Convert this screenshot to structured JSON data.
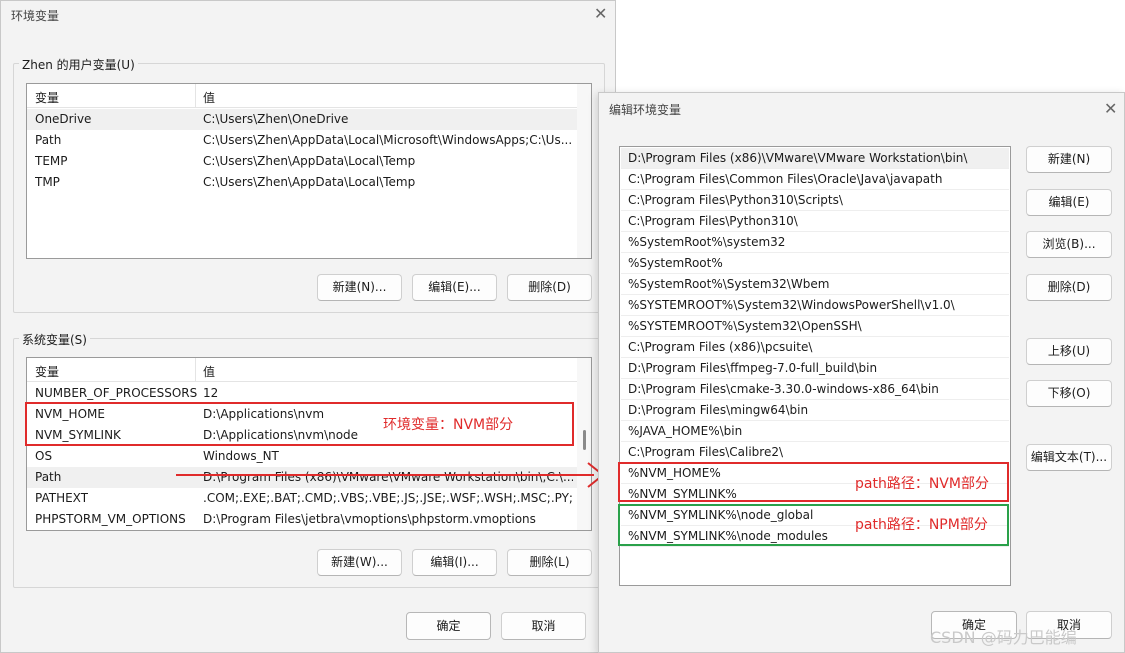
{
  "env_dialog": {
    "title": "环境变量",
    "user_group_label": "Zhen 的用户变量(U)",
    "col_var": "变量",
    "col_val": "值",
    "user_rows": [
      {
        "name": "OneDrive",
        "value": "C:\\Users\\Zhen\\OneDrive"
      },
      {
        "name": "Path",
        "value": "C:\\Users\\Zhen\\AppData\\Local\\Microsoft\\WindowsApps;C:\\Us..."
      },
      {
        "name": "TEMP",
        "value": "C:\\Users\\Zhen\\AppData\\Local\\Temp"
      },
      {
        "name": "TMP",
        "value": "C:\\Users\\Zhen\\AppData\\Local\\Temp"
      }
    ],
    "user_buttons": {
      "new": "新建(N)...",
      "edit": "编辑(E)...",
      "delete": "删除(D)"
    },
    "system_group_label": "系统变量(S)",
    "system_rows": [
      {
        "name": "NUMBER_OF_PROCESSORS",
        "value": "12"
      },
      {
        "name": "NVM_HOME",
        "value": "D:\\Applications\\nvm"
      },
      {
        "name": "NVM_SYMLINK",
        "value": "D:\\Applications\\nvm\\node"
      },
      {
        "name": "OS",
        "value": "Windows_NT"
      },
      {
        "name": "Path",
        "value": "D:\\Program Files (x86)\\VMware\\VMware Workstation\\bin\\;C:\\..."
      },
      {
        "name": "PATHEXT",
        "value": ".COM;.EXE;.BAT;.CMD;.VBS;.VBE;.JS;.JSE;.WSF;.WSH;.MSC;.PY;.P..."
      },
      {
        "name": "PHPSTORM_VM_OPTIONS",
        "value": "D:\\Program Files\\jetbra\\vmoptions\\phpstorm.vmoptions"
      }
    ],
    "system_buttons": {
      "new": "新建(W)...",
      "edit": "编辑(I)...",
      "delete": "删除(L)"
    },
    "ok": "确定",
    "cancel": "取消"
  },
  "edit_dialog": {
    "title": "编辑环境变量",
    "paths": [
      "D:\\Program Files (x86)\\VMware\\VMware Workstation\\bin\\",
      "C:\\Program Files\\Common Files\\Oracle\\Java\\javapath",
      "C:\\Program Files\\Python310\\Scripts\\",
      "C:\\Program Files\\Python310\\",
      "%SystemRoot%\\system32",
      "%SystemRoot%",
      "%SystemRoot%\\System32\\Wbem",
      "%SYSTEMROOT%\\System32\\WindowsPowerShell\\v1.0\\",
      "%SYSTEMROOT%\\System32\\OpenSSH\\",
      "C:\\Program Files (x86)\\pcsuite\\",
      "D:\\Program Files\\ffmpeg-7.0-full_build\\bin",
      "D:\\Program Files\\cmake-3.30.0-windows-x86_64\\bin",
      "D:\\Program Files\\mingw64\\bin",
      "%JAVA_HOME%\\bin",
      "C:\\Program Files\\Calibre2\\",
      "%NVM_HOME%",
      "%NVM_SYMLINK%",
      "%NVM_SYMLINK%\\node_global",
      "%NVM_SYMLINK%\\node_modules"
    ],
    "buttons": {
      "new": "新建(N)",
      "edit": "编辑(E)",
      "browse": "浏览(B)...",
      "delete": "删除(D)",
      "up": "上移(U)",
      "down": "下移(O)",
      "edit_text": "编辑文本(T)..."
    },
    "ok": "确定",
    "cancel": "取消"
  },
  "annotations": {
    "env_nvm": "环境变量：NVM部分",
    "path_nvm": "path路径：NVM部分",
    "path_npm": "path路径：NPM部分",
    "red": "#e02b2b",
    "green": "#2aa14a"
  },
  "watermark": "CSDN @码力巴能编",
  "icons": {
    "close": "close-icon",
    "arrow": "arrow-right-icon"
  }
}
